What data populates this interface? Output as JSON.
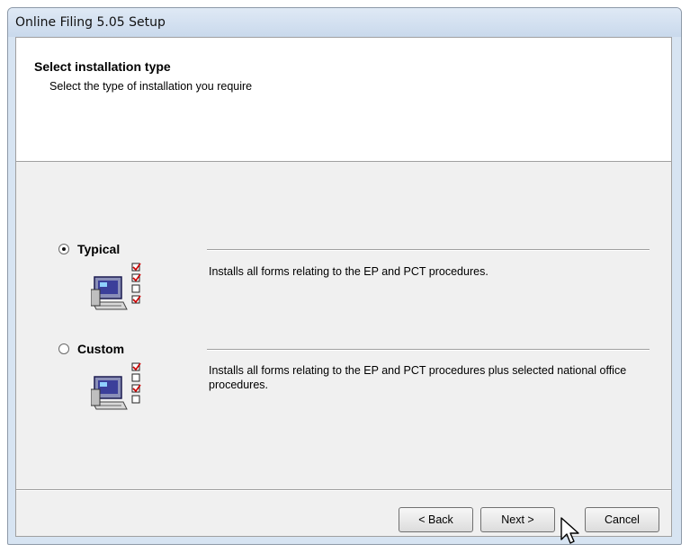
{
  "window": {
    "title": "Online Filing 5.05 Setup"
  },
  "header": {
    "title": "Select installation type",
    "subtitle": "Select the type of installation you require"
  },
  "options": [
    {
      "label": "Typical",
      "selected": true,
      "description": "Installs all forms relating to the EP and PCT procedures.",
      "icon": "computer-checklist-icon"
    },
    {
      "label": "Custom",
      "selected": false,
      "description": "Installs all forms relating to the EP and PCT procedures plus selected national office procedures.",
      "icon": "computer-checklist-icon"
    }
  ],
  "buttons": {
    "back": "< Back",
    "next": "Next >",
    "cancel": "Cancel"
  },
  "colors": {
    "dialog_bg": "#f0f0f0",
    "header_bg": "#ffffff",
    "title_bar": "#d7e4f2"
  }
}
